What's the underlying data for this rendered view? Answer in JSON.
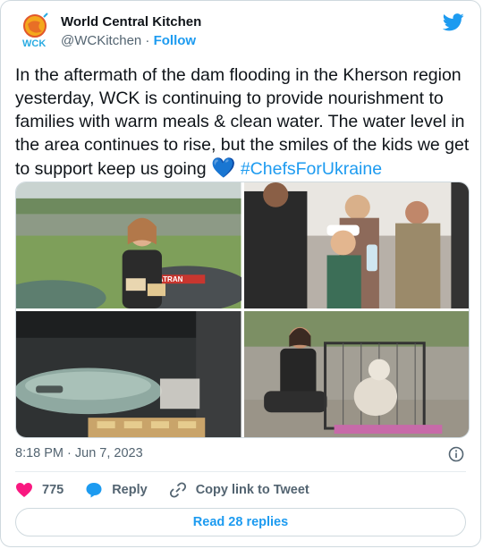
{
  "author": {
    "name": "World Central Kitchen",
    "handle": "@WCKitchen",
    "separator": "·",
    "follow_label": "Follow",
    "logo_text": "WCK"
  },
  "tweet": {
    "text": "In the aftermath of the dam flooding in the Kherson region yesterday, WCK is continuing to provide nourishment to families with warm meals & clean water. The water level in the area continues to rise, but the smiles of the kids we get to support keep us going",
    "emoji": "💙",
    "hashtag": "#ChefsForUkraine"
  },
  "media": {
    "photos": [
      {
        "name": "photo-girl-with-sandwiches",
        "boat_text": "ATRAN"
      },
      {
        "name": "photo-boy-with-water"
      },
      {
        "name": "photo-boat-with-supplies"
      },
      {
        "name": "photo-woman-with-dog"
      }
    ]
  },
  "meta": {
    "timestamp": "8:18 PM · Jun 7, 2023"
  },
  "actions": {
    "like_count": "775",
    "reply_label": "Reply",
    "copy_label": "Copy link to Tweet"
  },
  "footer": {
    "read_replies_label": "Read 28 replies"
  },
  "colors": {
    "link": "#1d9bf0",
    "like": "#f91880",
    "secondary_text": "#536471"
  }
}
